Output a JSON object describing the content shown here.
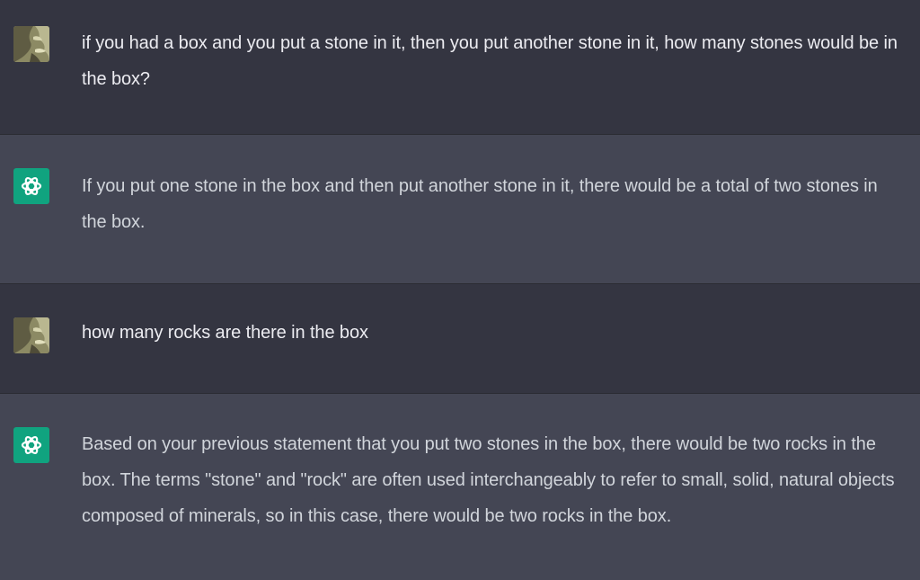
{
  "conversation": {
    "messages": [
      {
        "role": "user",
        "avatar_icon": "user-statue-avatar-icon",
        "text": "if you had a box and you put a stone in it, then you put another stone in it, how many stones would be in the box?"
      },
      {
        "role": "assistant",
        "avatar_icon": "openai-logo-icon",
        "text": "If you put one stone in the box and then put another stone in it, there would be a total of two stones in the box."
      },
      {
        "role": "user",
        "avatar_icon": "user-statue-avatar-icon",
        "text": "how many rocks are there in the box"
      },
      {
        "role": "assistant",
        "avatar_icon": "openai-logo-icon",
        "text": "Based on your previous statement that you put two stones in the box, there would be two rocks in the box. The terms \"stone\" and \"rock\" are often used interchangeably to refer to small, solid, natural objects composed of minerals, so in this case, there would be two rocks in the box."
      }
    ]
  },
  "colors": {
    "user_bg": "#343541",
    "assistant_bg": "#444654",
    "gpt_avatar": "#10a37f",
    "text": "#ececf1"
  }
}
